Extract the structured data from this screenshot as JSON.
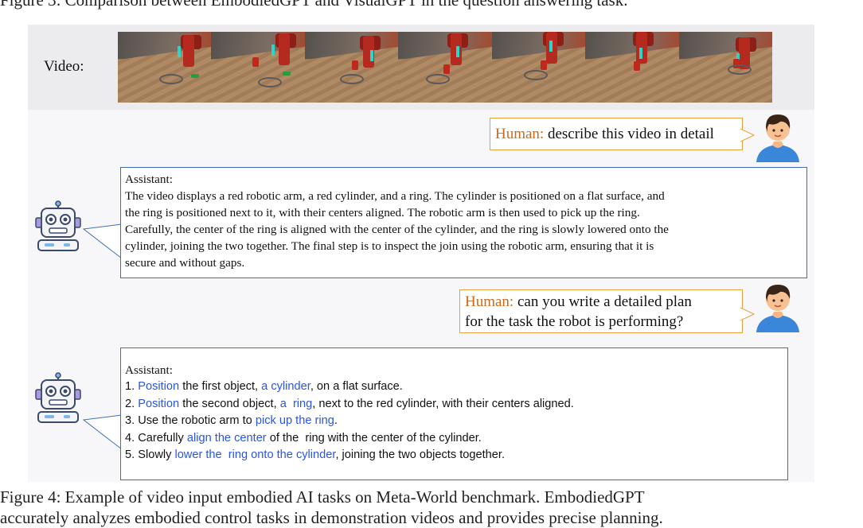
{
  "top_caption": "Figure 3: Comparison between EmbodiedGPT and VisualGPT in the question answering task.",
  "video_label": "Video:",
  "frames": [
    {
      "name": "video-frame-1"
    },
    {
      "name": "video-frame-2"
    },
    {
      "name": "video-frame-3"
    },
    {
      "name": "video-frame-4"
    },
    {
      "name": "video-frame-5"
    },
    {
      "name": "video-frame-6"
    },
    {
      "name": "video-frame-7"
    }
  ],
  "human1": {
    "speaker": "Human:",
    "text": "describe this video in detail"
  },
  "assistant1": {
    "speaker": "Assistant:",
    "lines": [
      "The video displays a red robotic arm, a red cylinder, and a ring. The cylinder is positioned on a flat surface, and",
      "the ring is positioned next to it, with their centers aligned. The robotic arm is then used to pick up the ring.",
      "Carefully, the center of the ring is aligned with the center of the cylinder, and the ring is slowly lowered onto the",
      "cylinder, joining the two together. The final step is to inspect the join using the robotic arm, ensuring that it is",
      "secure and without gaps."
    ]
  },
  "human2": {
    "speaker": "Human:",
    "line1": "can you write a detailed plan",
    "line2": "for the task the robot is performing?"
  },
  "assistant2": {
    "speaker": "Assistant:",
    "steps": [
      [
        {
          "t": "1. ",
          "hl": false
        },
        {
          "t": "Position",
          "hl": true
        },
        {
          "t": " the first object, ",
          "hl": false
        },
        {
          "t": "a cylinder",
          "hl": true
        },
        {
          "t": ", on a flat surface.",
          "hl": false
        }
      ],
      [
        {
          "t": "2. ",
          "hl": false
        },
        {
          "t": "Position",
          "hl": true
        },
        {
          "t": " the second object, ",
          "hl": false
        },
        {
          "t": "a  ring",
          "hl": true
        },
        {
          "t": ", next to the red cylinder, with their centers aligned.",
          "hl": false
        }
      ],
      [
        {
          "t": "3. Use the robotic arm to ",
          "hl": false
        },
        {
          "t": "pick up the ring",
          "hl": true
        },
        {
          "t": ".",
          "hl": false
        }
      ],
      [
        {
          "t": "4. Carefully ",
          "hl": false
        },
        {
          "t": "align the center",
          "hl": true
        },
        {
          "t": " of the  ring with the center of the cylinder.",
          "hl": false
        }
      ],
      [
        {
          "t": "5. Slowly ",
          "hl": false
        },
        {
          "t": "lower the  ring onto the cylinder",
          "hl": true
        },
        {
          "t": ", joining the two objects together.",
          "hl": false
        }
      ]
    ]
  },
  "colors": {
    "human_border": "#e7a03c",
    "human_name": "#c96a1a",
    "assistant_border": "#3f6fb0",
    "highlight": "#2a55e6"
  },
  "caption_lines": [
    "Figure 4: Example of video input embodied AI tasks on Meta-World benchmark. EmbodiedGPT",
    "accurately analyzes embodied control tasks in demonstration videos and provides precise planning."
  ]
}
